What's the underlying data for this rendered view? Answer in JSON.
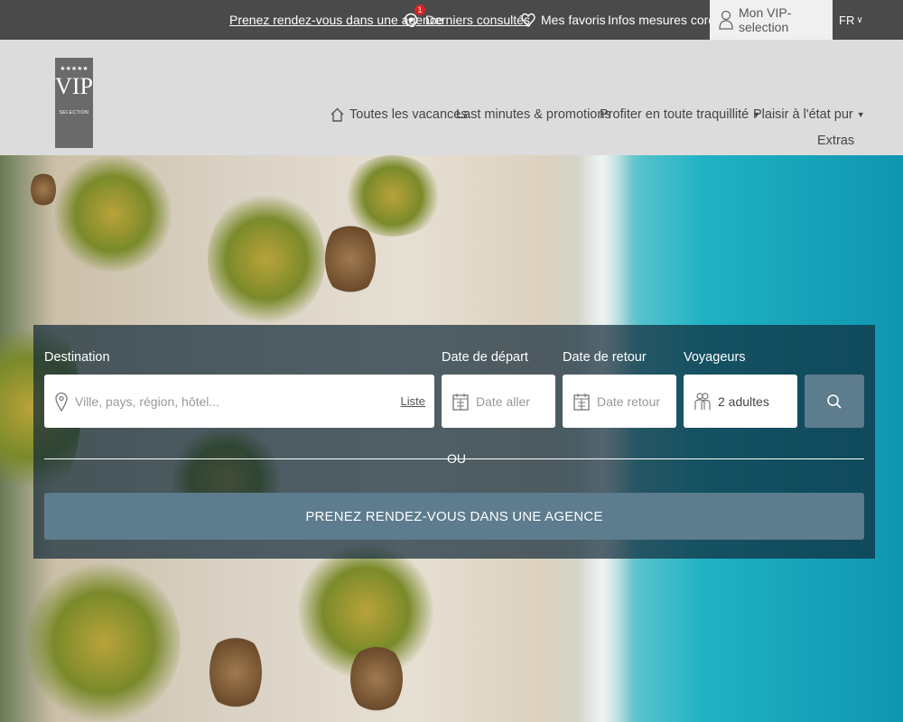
{
  "topbar": {
    "appointment": "Prenez rendez-vous dans une agence",
    "recent_badge": "1",
    "recent": "Derniers consultés",
    "favorites": "Mes favoris",
    "corona": "Infos mesures corona",
    "vip_account": "Mon VIP-selection",
    "language": "FR"
  },
  "logo": {
    "stars": "★★★★★",
    "text": "VIP",
    "sub": "SELECTION"
  },
  "nav": {
    "items": [
      {
        "label": "Toutes les vacances",
        "icon": "home-icon"
      },
      {
        "label": "Last minutes & promotions"
      },
      {
        "label": "Profiter en toute traquillité",
        "dropdown": true
      },
      {
        "label": "Plaisir à l'état pur",
        "dropdown": true
      }
    ],
    "extra": "Extras"
  },
  "search": {
    "destination_label": "Destination",
    "destination_placeholder": "Ville, pays, région, hôtel...",
    "list_link": "Liste",
    "departure_label": "Date de départ",
    "departure_placeholder": "Date aller",
    "return_label": "Date de retour",
    "return_placeholder": "Date retour",
    "travelers_label": "Voyageurs",
    "travelers_value": "2 adultes",
    "or_text": "OU",
    "agency_button": "PRENEZ RENDEZ-VOUS DANS UNE AGENCE"
  },
  "colors": {
    "topbar": "#4a4a4a",
    "header": "#dcdcdc",
    "accent_button": "#5d7c8d",
    "badge": "#dd2222"
  }
}
